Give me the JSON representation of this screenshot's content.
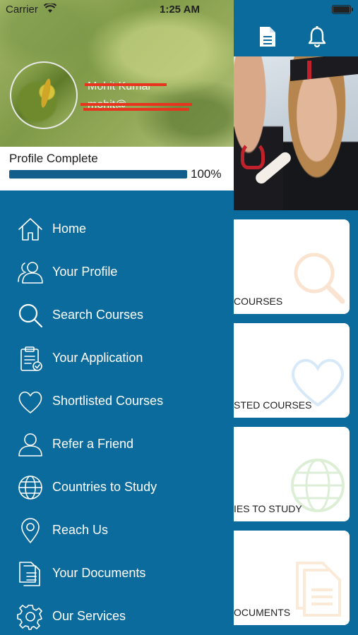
{
  "status_bar": {
    "carrier": "Carrier",
    "time": "1:25 AM"
  },
  "drawer": {
    "user_name": "Mohit Kumar",
    "user_email": "mohit@",
    "profile_title": "Profile Complete",
    "progress_percent_label": "100%",
    "progress_value": 1.0,
    "menu": [
      {
        "label": "Home",
        "icon": "home-icon"
      },
      {
        "label": "Your Profile",
        "icon": "users-icon"
      },
      {
        "label": "Search Courses",
        "icon": "search-icon"
      },
      {
        "label": "Your Application",
        "icon": "clipboard-check-icon"
      },
      {
        "label": "Shortlisted Courses",
        "icon": "heart-icon"
      },
      {
        "label": "Refer a Friend",
        "icon": "user-icon"
      },
      {
        "label": "Countries to Study",
        "icon": "globe-icon"
      },
      {
        "label": "Reach Us",
        "icon": "location-pin-icon"
      },
      {
        "label": "Your Documents",
        "icon": "documents-icon"
      },
      {
        "label": "Our Services",
        "icon": "gear-icon"
      }
    ]
  },
  "main": {
    "header_icons": [
      "document-icon",
      "bell-icon"
    ],
    "cards": [
      {
        "label": "COURSES",
        "icon": "search-icon"
      },
      {
        "label": "STED COURSES",
        "icon": "heart-icon"
      },
      {
        "label": "IES TO STUDY",
        "icon": "globe-icon"
      },
      {
        "label": "OCUMENTS",
        "icon": "documents-icon"
      }
    ]
  },
  "colors": {
    "primary": "#0a6b9c",
    "progress": "#115f8a",
    "redaction": "#e8331f"
  }
}
